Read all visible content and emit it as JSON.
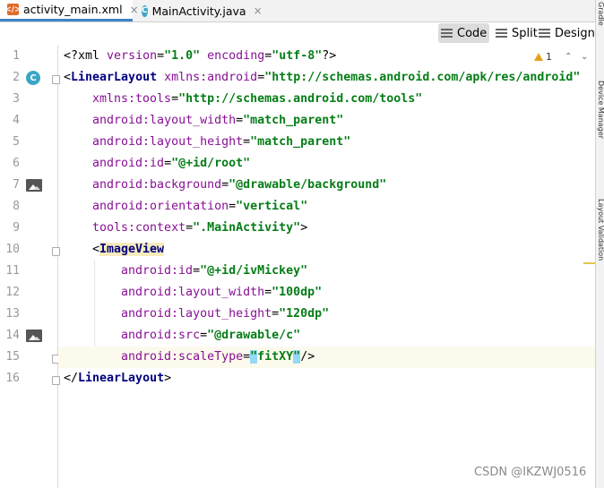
{
  "tabs": [
    {
      "label": "activity_main.xml",
      "close": "×",
      "active": true,
      "icon": "xml-file-icon"
    },
    {
      "label": "MainActivity.java",
      "close": "×",
      "active": false,
      "icon": "java-class-icon"
    }
  ],
  "view_modes": {
    "code": "Code",
    "split": "Split",
    "design": "Design"
  },
  "inspection": {
    "warning_count": "1"
  },
  "side_panels": {
    "top": "Gradle",
    "device_manager": "Device Manager",
    "layout_validation": "Layout Validation"
  },
  "colors": {
    "tag": "#000080",
    "attribute": "#871094",
    "value": "#067d17",
    "active_tab": "#4083c9",
    "current_line": "#fcfaed"
  },
  "line_numbers": [
    "1",
    "2",
    "3",
    "4",
    "5",
    "6",
    "7",
    "8",
    "9",
    "10",
    "11",
    "12",
    "13",
    "14",
    "15",
    "16"
  ],
  "gutter_c": "C",
  "code": {
    "l1": {
      "a": "<?xml ",
      "b": "version",
      "c": "=",
      "d": "\"1.0\"",
      "e": " ",
      "f": "encoding",
      "g": "=",
      "h": "\"utf-8\"",
      "i": "?>"
    },
    "l2": {
      "a": "<",
      "b": "LinearLayout",
      "c": " ",
      "d": "xmlns:android",
      "e": "=",
      "f": "\"http://schemas.android.com/apk/res/android\""
    },
    "l3": {
      "a": "xmlns:tools",
      "b": "=",
      "c": "\"http://schemas.android.com/tools\""
    },
    "l4": {
      "a": "android",
      "b": ":layout_width",
      "c": "=",
      "d": "\"match_parent\""
    },
    "l5": {
      "a": "android",
      "b": ":layout_height",
      "c": "=",
      "d": "\"match_parent\""
    },
    "l6": {
      "a": "android",
      "b": ":id",
      "c": "=",
      "d": "\"@+id/root\""
    },
    "l7": {
      "a": "android",
      "b": ":background",
      "c": "=",
      "d": "\"@drawable/background\""
    },
    "l8": {
      "a": "android",
      "b": ":orientation",
      "c": "=",
      "d": "\"vertical\""
    },
    "l9": {
      "a": "tools",
      "b": ":context",
      "c": "=",
      "d": "\".MainActivity\"",
      "e": ">"
    },
    "l10": {
      "a": "<",
      "b": "ImageView"
    },
    "l11": {
      "a": "android",
      "b": ":id",
      "c": "=",
      "d": "\"@+id/ivMickey\""
    },
    "l12": {
      "a": "android",
      "b": ":layout_width",
      "c": "=",
      "d": "\"100dp\""
    },
    "l13": {
      "a": "android",
      "b": ":layout_height",
      "c": "=",
      "d": "\"120dp\""
    },
    "l14": {
      "a": "android",
      "b": ":src",
      "c": "=",
      "d": "\"@drawable/c\""
    },
    "l15": {
      "a": "android",
      "b": ":scaleType",
      "c": "=",
      "d1": "\"",
      "d2": "fitXY",
      "d3": "\"",
      "e": "/>"
    },
    "l16": {
      "a": "</",
      "b": "LinearLayout",
      "c": ">"
    }
  },
  "watermark": "CSDN @IKZWJ0516"
}
